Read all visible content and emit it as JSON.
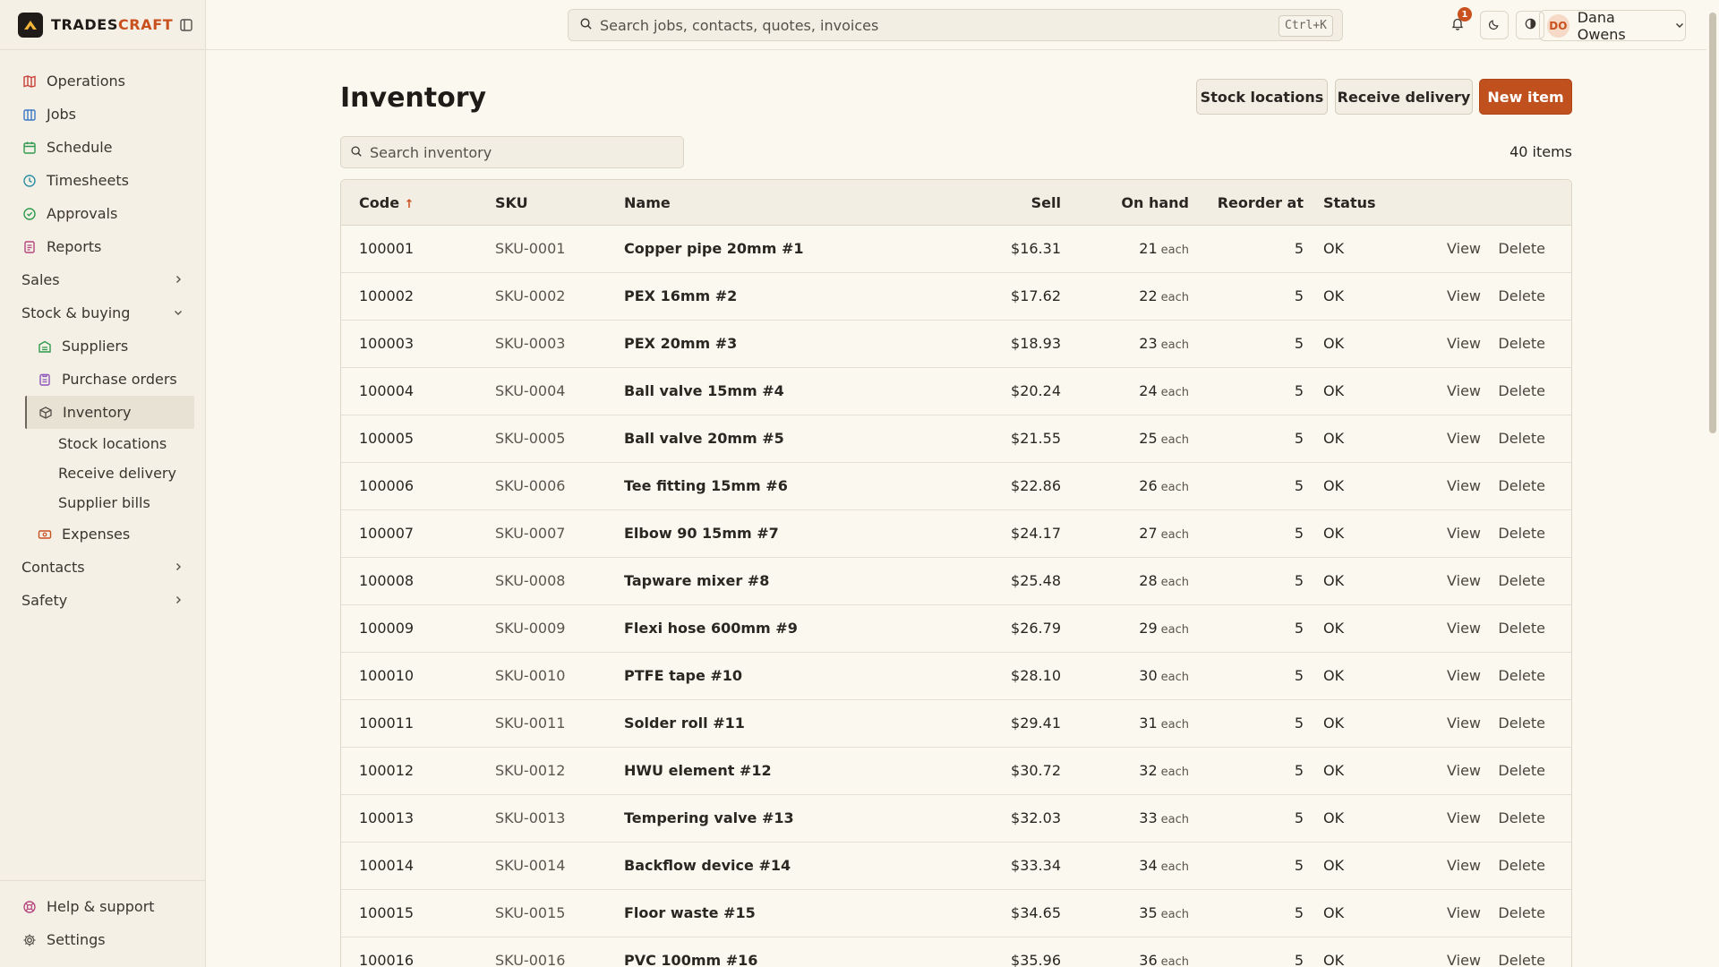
{
  "brand": {
    "name_main": "TRADES",
    "name_accent": "CRAFT"
  },
  "sidebar": {
    "items": [
      {
        "name": "operations",
        "label": "Operations",
        "color": "#c8413a"
      },
      {
        "name": "jobs",
        "label": "Jobs",
        "color": "#3b78c4"
      },
      {
        "name": "schedule",
        "label": "Schedule",
        "color": "#2f9a4d"
      },
      {
        "name": "timesheets",
        "label": "Timesheets",
        "color": "#2c8fa3"
      },
      {
        "name": "approvals",
        "label": "Approvals",
        "color": "#2f9a4d"
      },
      {
        "name": "reports",
        "label": "Reports",
        "color": "#b5457e"
      }
    ],
    "groups": {
      "sales": "Sales",
      "stock": "Stock & buying",
      "contacts": "Contacts",
      "safety": "Safety"
    },
    "stock_children": {
      "suppliers": "Suppliers",
      "purchase_orders": "Purchase orders",
      "inventory": "Inventory",
      "stock_locations": "Stock locations",
      "receive_delivery": "Receive delivery",
      "supplier_bills": "Supplier bills",
      "expenses": "Expenses"
    },
    "bottom": {
      "help": "Help & support",
      "settings": "Settings"
    }
  },
  "topbar": {
    "search_placeholder": "Search jobs, contacts, quotes, invoices",
    "shortcut": "Ctrl+K",
    "notification_count": "1",
    "user": {
      "initials": "DO",
      "name": "Dana Owens"
    }
  },
  "page": {
    "title": "Inventory",
    "buttons": {
      "stock_locations": "Stock locations",
      "receive_delivery": "Receive delivery",
      "new_item": "New item"
    },
    "search_placeholder": "Search inventory",
    "item_count": "40 items"
  },
  "table": {
    "columns": {
      "code": "Code",
      "sku": "SKU",
      "name": "Name",
      "sell": "Sell",
      "on_hand": "On hand",
      "reorder_at": "Reorder at",
      "status": "Status"
    },
    "sort_indicator": "↑",
    "actions": {
      "view": "View",
      "delete": "Delete"
    },
    "rows": [
      {
        "code": "100001",
        "sku": "SKU-0001",
        "name": "Copper pipe 20mm #1",
        "sell": "$16.31",
        "on_hand": "21",
        "unit": "each",
        "reorder_at": "5",
        "status": "OK"
      },
      {
        "code": "100002",
        "sku": "SKU-0002",
        "name": "PEX 16mm #2",
        "sell": "$17.62",
        "on_hand": "22",
        "unit": "each",
        "reorder_at": "5",
        "status": "OK"
      },
      {
        "code": "100003",
        "sku": "SKU-0003",
        "name": "PEX 20mm #3",
        "sell": "$18.93",
        "on_hand": "23",
        "unit": "each",
        "reorder_at": "5",
        "status": "OK"
      },
      {
        "code": "100004",
        "sku": "SKU-0004",
        "name": "Ball valve 15mm #4",
        "sell": "$20.24",
        "on_hand": "24",
        "unit": "each",
        "reorder_at": "5",
        "status": "OK"
      },
      {
        "code": "100005",
        "sku": "SKU-0005",
        "name": "Ball valve 20mm #5",
        "sell": "$21.55",
        "on_hand": "25",
        "unit": "each",
        "reorder_at": "5",
        "status": "OK"
      },
      {
        "code": "100006",
        "sku": "SKU-0006",
        "name": "Tee fitting 15mm #6",
        "sell": "$22.86",
        "on_hand": "26",
        "unit": "each",
        "reorder_at": "5",
        "status": "OK"
      },
      {
        "code": "100007",
        "sku": "SKU-0007",
        "name": "Elbow 90 15mm #7",
        "sell": "$24.17",
        "on_hand": "27",
        "unit": "each",
        "reorder_at": "5",
        "status": "OK"
      },
      {
        "code": "100008",
        "sku": "SKU-0008",
        "name": "Tapware mixer #8",
        "sell": "$25.48",
        "on_hand": "28",
        "unit": "each",
        "reorder_at": "5",
        "status": "OK"
      },
      {
        "code": "100009",
        "sku": "SKU-0009",
        "name": "Flexi hose 600mm #9",
        "sell": "$26.79",
        "on_hand": "29",
        "unit": "each",
        "reorder_at": "5",
        "status": "OK"
      },
      {
        "code": "100010",
        "sku": "SKU-0010",
        "name": "PTFE tape #10",
        "sell": "$28.10",
        "on_hand": "30",
        "unit": "each",
        "reorder_at": "5",
        "status": "OK"
      },
      {
        "code": "100011",
        "sku": "SKU-0011",
        "name": "Solder roll #11",
        "sell": "$29.41",
        "on_hand": "31",
        "unit": "each",
        "reorder_at": "5",
        "status": "OK"
      },
      {
        "code": "100012",
        "sku": "SKU-0012",
        "name": "HWU element #12",
        "sell": "$30.72",
        "on_hand": "32",
        "unit": "each",
        "reorder_at": "5",
        "status": "OK"
      },
      {
        "code": "100013",
        "sku": "SKU-0013",
        "name": "Tempering valve #13",
        "sell": "$32.03",
        "on_hand": "33",
        "unit": "each",
        "reorder_at": "5",
        "status": "OK"
      },
      {
        "code": "100014",
        "sku": "SKU-0014",
        "name": "Backflow device #14",
        "sell": "$33.34",
        "on_hand": "34",
        "unit": "each",
        "reorder_at": "5",
        "status": "OK"
      },
      {
        "code": "100015",
        "sku": "SKU-0015",
        "name": "Floor waste #15",
        "sell": "$34.65",
        "on_hand": "35",
        "unit": "each",
        "reorder_at": "5",
        "status": "OK"
      },
      {
        "code": "100016",
        "sku": "SKU-0016",
        "name": "PVC 100mm #16",
        "sell": "$35.96",
        "on_hand": "36",
        "unit": "each",
        "reorder_at": "5",
        "status": "OK"
      }
    ]
  },
  "colors": {
    "accent": "#c0501d",
    "background": "#fbf8ef",
    "sidebar": "#f4f0e6"
  }
}
